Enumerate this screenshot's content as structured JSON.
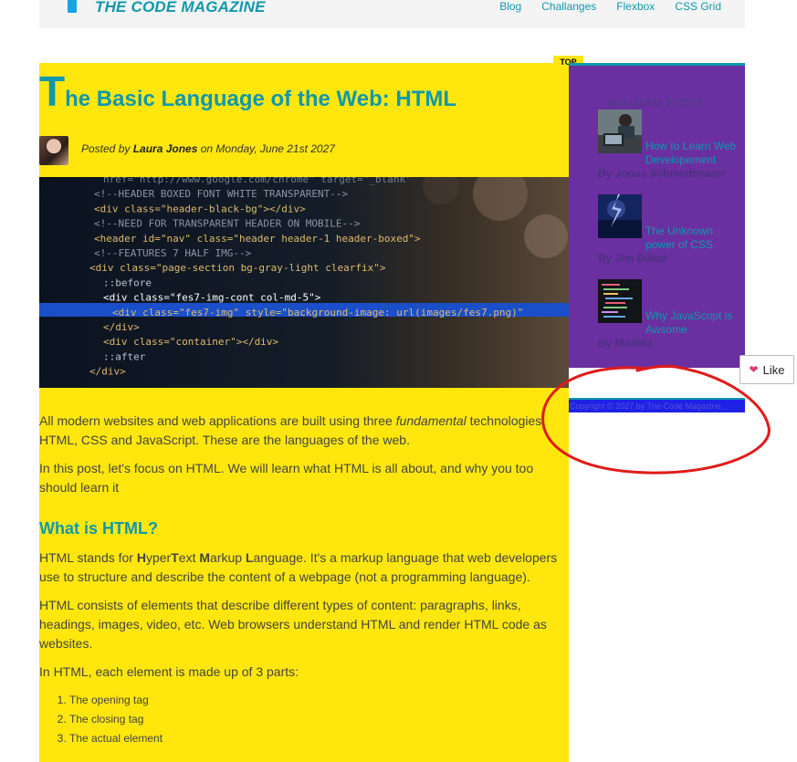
{
  "nav": {
    "logo": "THE CODE MAGAZINE",
    "links": [
      "Blog",
      "Challanges",
      "Flexbox",
      "CSS Grid"
    ]
  },
  "post": {
    "title_first": "T",
    "title_rest": "he Basic Language of the Web: HTML",
    "byline_prefix": "Posted by ",
    "author": "Laura Jones",
    "byline_suffix": " on Monday, June 21st 2027",
    "intro1_a": "All modern websites and web applications are built using three ",
    "intro1_em": "fundamental",
    "intro1_b": " technologies: HTML, CSS and JavaScript. These are the languages of the web.",
    "intro2": "In this post, let's focus on HTML. We will learn what HTML is all about, and why you too should learn it",
    "heading": "What is HTML?",
    "p1_a": "HTML stands for ",
    "p1_h": "H",
    "p1_b": "yper",
    "p1_t": "T",
    "p1_c": "ext ",
    "p1_m": "M",
    "p1_d": "arkup ",
    "p1_l": "L",
    "p1_e": "anguage. It's a markup language that web developers use to structure and describe the content of a webpage (not a programming language).",
    "p2": "HTML consists of elements that describe different types of content: paragraphs, links, headings, images, video, etc. Web browsers understand HTML and render HTML code as websites.",
    "p3": "In HTML, each element is made up of 3 parts:",
    "list": [
      "The opening tag",
      "The closing tag",
      "The actual element"
    ]
  },
  "hero_code": [
    "  href=\"http://www.google.com/chrome\" target=\"_blank\"",
    "<!--HEADER BOXED FONT WHITE TRANSPARENT-->",
    "<div class=\"header-black-bg\"></div>",
    "<!--NEED FOR TRANSPARENT HEADER ON MOBILE-->",
    "<header id=\"nav\" class=\"header header-1 header-boxed\">",
    "<!--FEATURES 7 HALF IMG-->",
    "<div class=\"page-section bg-gray-light clearfix\">",
    "::before",
    "<div class=\"fes7-img-cont col-md-5\">",
    "<div class=\"fes7-img\" style=\"background-image: url(images/fes7.png)\"",
    "</div>",
    "<div class=\"container\"></div>",
    "::after",
    "</div>"
  ],
  "sidebar": {
    "top_tag": "TOP",
    "heading": "RELATED POSTS",
    "posts": [
      {
        "title": "How to Learn Web Developement",
        "by": "By Jonas Schmedtmann"
      },
      {
        "title": "The Unknown power of CSS",
        "by": "By Jim Dillon"
      },
      {
        "title": "Why JavaScript is Awsome",
        "by": "By Matilda"
      }
    ],
    "footer": "Copyright © 2027 by The Code Magazine."
  },
  "like": {
    "label": "Like"
  },
  "colors": {
    "accent": "#1098ad",
    "post_bg": "#ffe70e",
    "sidebar_bg": "#6a2fa0",
    "footer_bg": "#1e22e6",
    "annotation": "#e01b1b"
  }
}
